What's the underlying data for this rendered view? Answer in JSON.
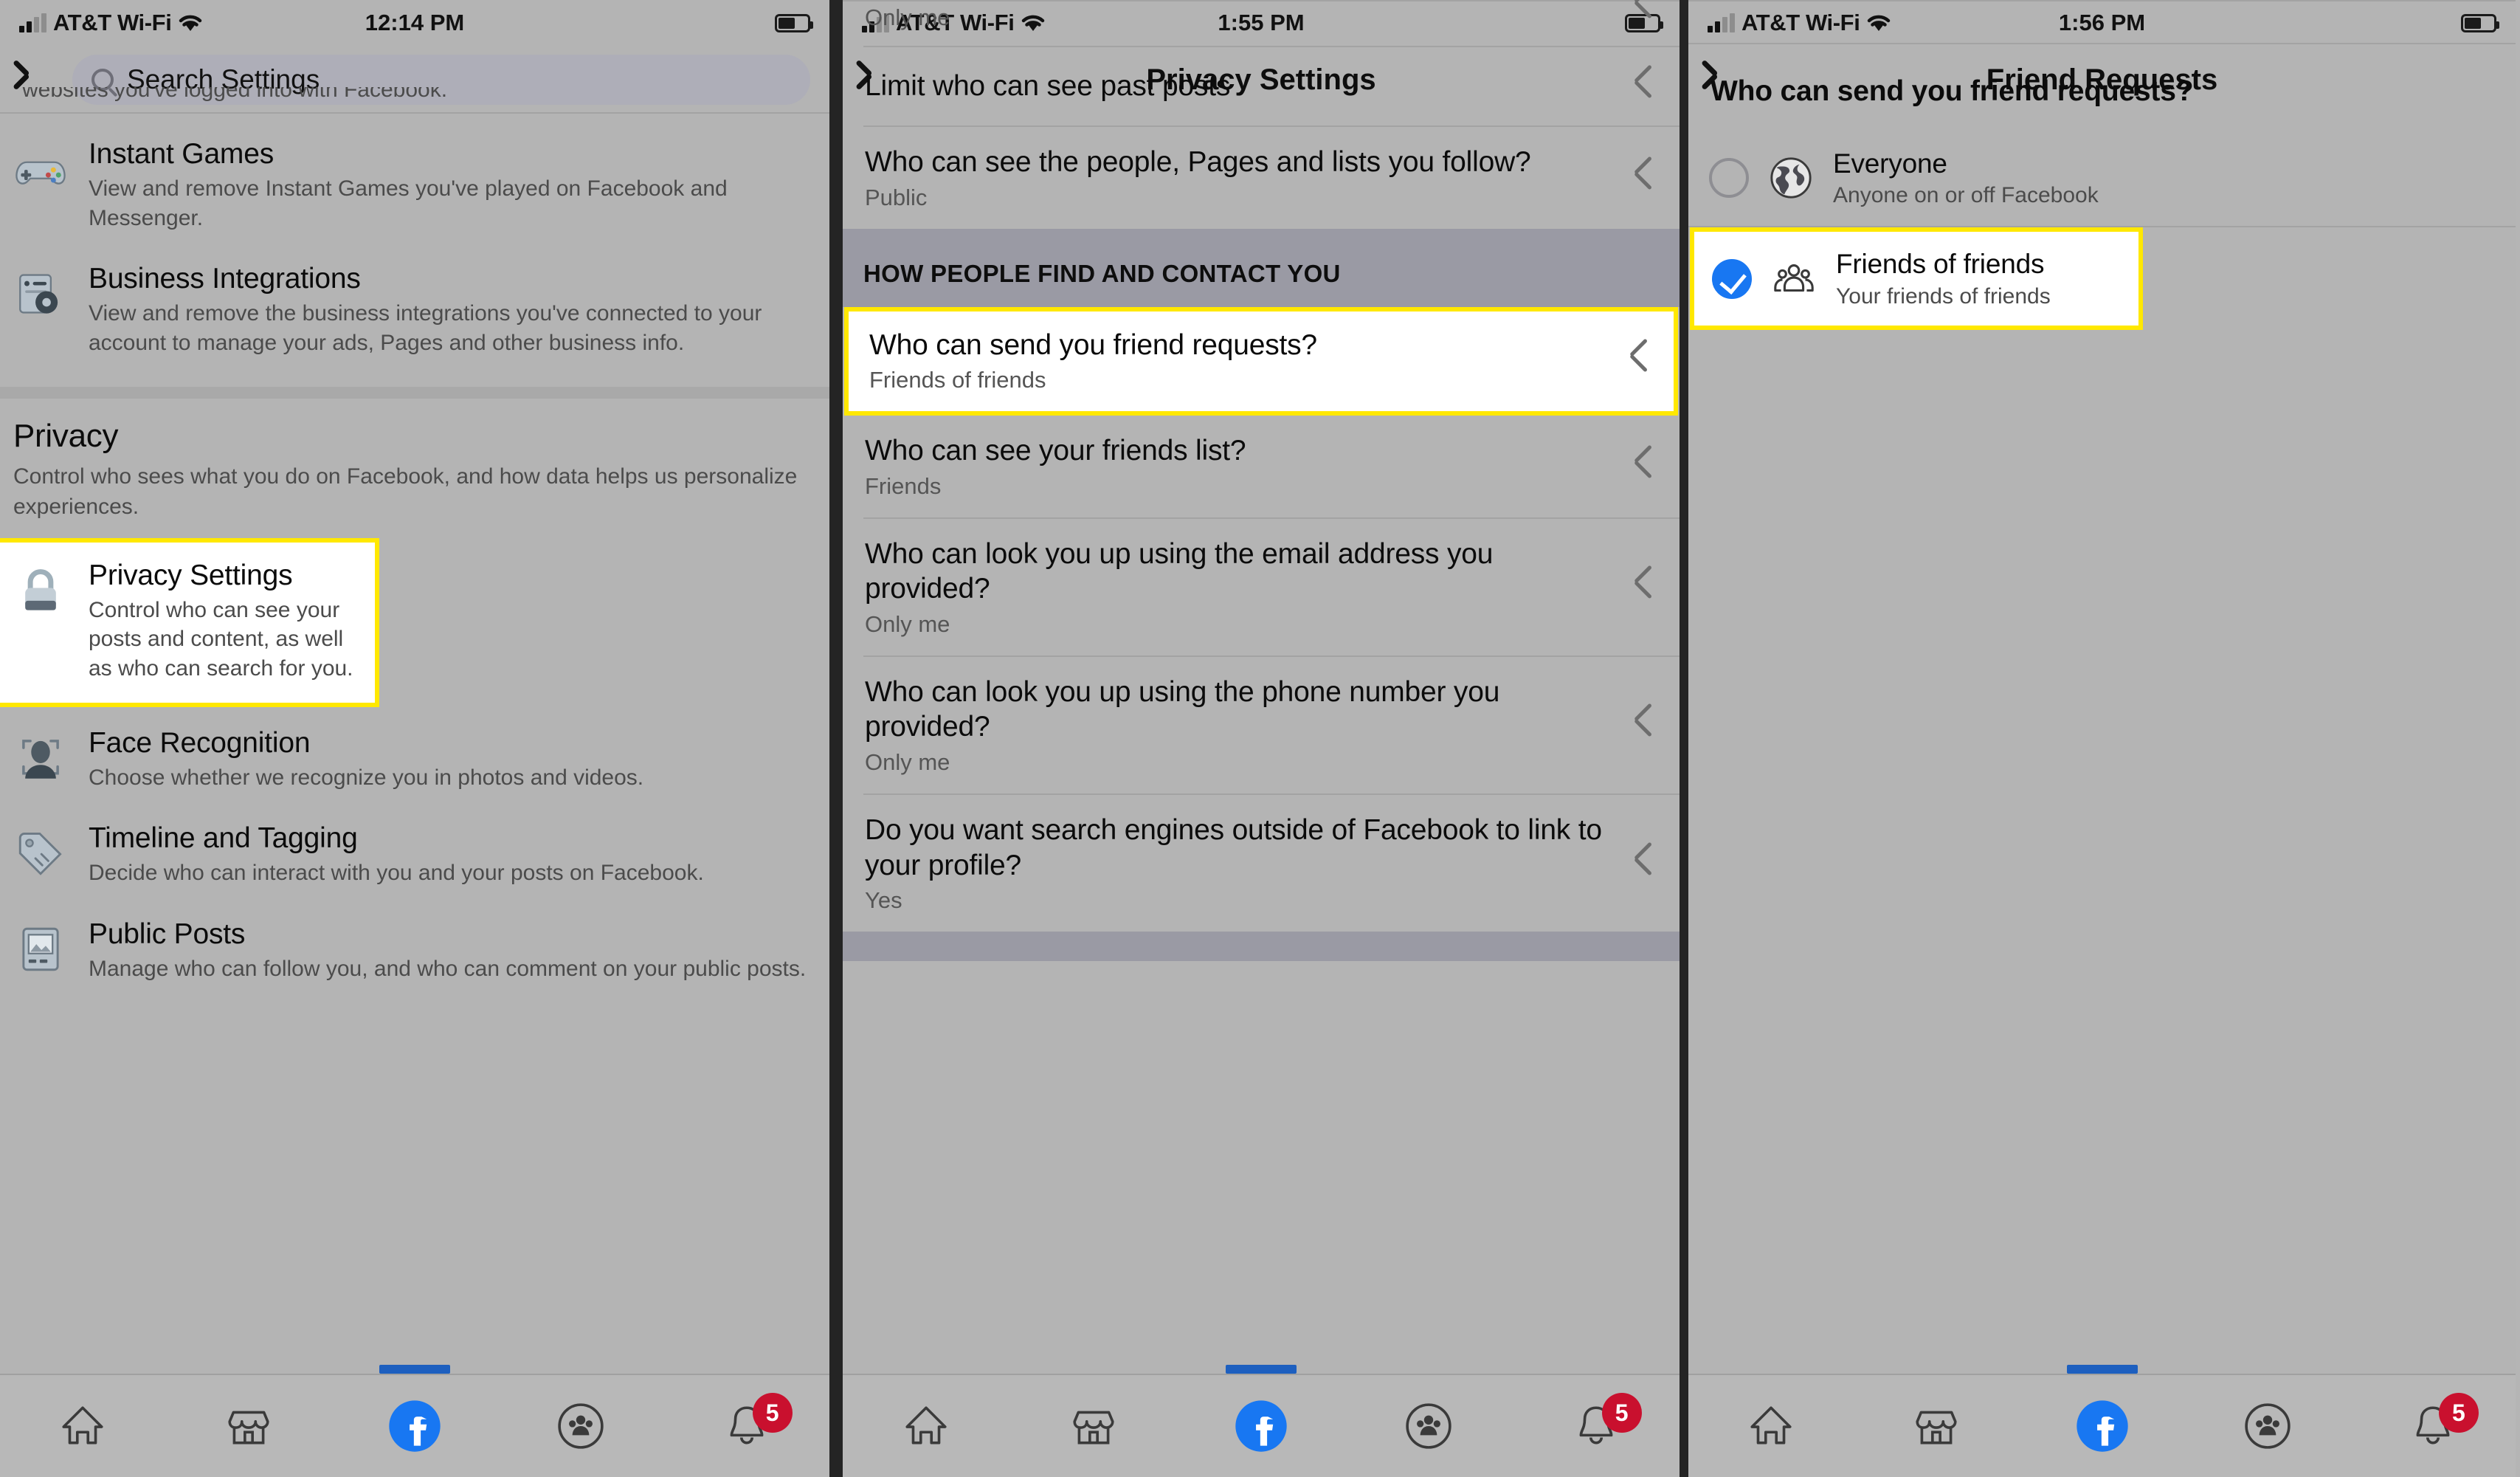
{
  "panels": [
    {
      "id": "settings-list",
      "status": {
        "carrier": "AT&T Wi-Fi",
        "time": "12:14 PM",
        "signal_icon": "cellular-bars-icon",
        "wifi_icon": "wifi-icon",
        "battery_icon": "battery-icon"
      },
      "nav": {
        "back_icon": "back-chevron-icon",
        "search_placeholder": "Search Settings",
        "search_icon": "search-icon"
      },
      "cut_off_text": "websites you've logged into with Facebook.",
      "items": [
        {
          "icon": "game-controller-icon",
          "title": "Instant Games",
          "desc": "View and remove Instant Games you've played on Facebook and Messenger.",
          "highlighted": false
        },
        {
          "icon": "business-integrations-icon",
          "title": "Business Integrations",
          "desc": "View and remove the business integrations you've connected to your account to manage your ads, Pages and other business info.",
          "highlighted": false
        }
      ],
      "section": {
        "title": "Privacy",
        "desc": "Control who sees what you do on Facebook, and how data helps us personalize experiences."
      },
      "privacy_items": [
        {
          "icon": "lock-icon",
          "title": "Privacy Settings",
          "desc": "Control who can see your posts and content, as well as who can search for you.",
          "highlighted": true
        },
        {
          "icon": "face-recognition-icon",
          "title": "Face Recognition",
          "desc": "Choose whether we recognize you in photos and videos.",
          "highlighted": false
        },
        {
          "icon": "tag-icon",
          "title": "Timeline and Tagging",
          "desc": "Decide who can interact with you and your posts on Facebook.",
          "highlighted": false
        },
        {
          "icon": "photo-icon",
          "title": "Public Posts",
          "desc": "Manage who can follow you, and who can comment on your public posts.",
          "highlighted": false
        }
      ]
    },
    {
      "id": "privacy-settings",
      "status": {
        "carrier": "AT&T Wi-Fi",
        "time": "1:55 PM",
        "signal_icon": "cellular-bars-icon",
        "wifi_icon": "wifi-icon",
        "battery_icon": "battery-icon"
      },
      "nav": {
        "back_icon": "back-chevron-icon",
        "title": "Privacy Settings"
      },
      "top_partial_value": "Only me",
      "rows_before": [
        {
          "question": "Limit who can see past posts",
          "value": "",
          "highlighted": false
        },
        {
          "question": "Who can see the people, Pages and lists you follow?",
          "value": "Public",
          "highlighted": false
        }
      ],
      "group_header": "HOW PEOPLE FIND AND CONTACT YOU",
      "rows_after": [
        {
          "question": "Who can send you friend requests?",
          "value": "Friends of friends",
          "highlighted": true
        },
        {
          "question": "Who can see your friends list?",
          "value": "Friends",
          "highlighted": false
        },
        {
          "question": "Who can look you up using the email address you provided?",
          "value": "Only me",
          "highlighted": false
        },
        {
          "question": "Who can look you up using the phone number you provided?",
          "value": "Only me",
          "highlighted": false
        },
        {
          "question": "Do you want search engines outside of Facebook to link to your profile?",
          "value": "Yes",
          "highlighted": false
        }
      ]
    },
    {
      "id": "friend-requests",
      "status": {
        "carrier": "AT&T Wi-Fi",
        "time": "1:56 PM",
        "signal_icon": "cellular-bars-icon",
        "wifi_icon": "wifi-icon",
        "battery_icon": "battery-icon"
      },
      "nav": {
        "back_icon": "back-chevron-icon",
        "title": "Friend Requests"
      },
      "question": "Who can send you friend requests?",
      "options": [
        {
          "icon": "globe-icon",
          "label": "Everyone",
          "desc": "Anyone on or off Facebook",
          "selected": false,
          "highlighted": false
        },
        {
          "icon": "friends-group-icon",
          "label": "Friends of friends",
          "desc": "Your friends of friends",
          "selected": true,
          "highlighted": true
        }
      ]
    }
  ],
  "tabbar": {
    "items": [
      {
        "icon": "home-icon",
        "label": "Home",
        "badge": ""
      },
      {
        "icon": "marketplace-icon",
        "label": "Marketplace",
        "badge": ""
      },
      {
        "icon": "facebook-logo-icon",
        "label": "Facebook",
        "badge": ""
      },
      {
        "icon": "groups-icon",
        "label": "Groups",
        "badge": ""
      },
      {
        "icon": "bell-icon",
        "label": "Notifications",
        "badge": "5"
      }
    ]
  },
  "colors": {
    "highlight": "#ffe800",
    "accent_blue": "#1877f2",
    "badge_red": "#c9102e",
    "page_bg": "#b4b4b4",
    "group_header_bg": "#9a9aa4"
  }
}
